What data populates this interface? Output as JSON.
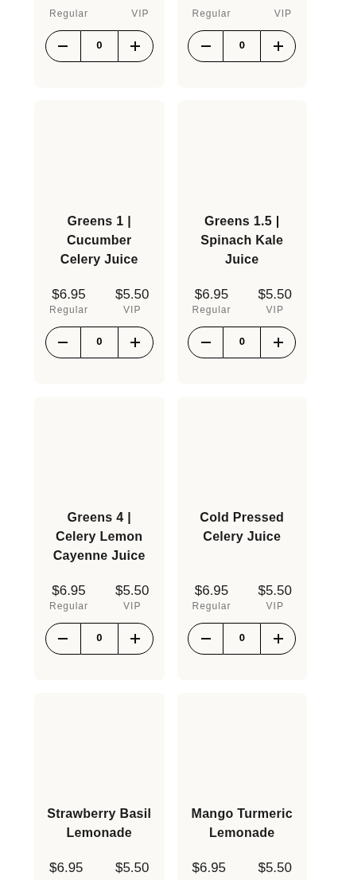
{
  "products": [
    {
      "regular_label": "Regular",
      "vip_label": "VIP",
      "quantity": "0"
    },
    {
      "regular_label": "Regular",
      "vip_label": "VIP",
      "quantity": "0"
    },
    {
      "title": "Greens 1 | Cucumber Celery Juice",
      "regular_price": "$6.95",
      "regular_label": "Regular",
      "vip_price": "$5.50",
      "vip_label": "VIP",
      "quantity": "0"
    },
    {
      "title": "Greens 1.5 | Spinach Kale Juice",
      "regular_price": "$6.95",
      "regular_label": "Regular",
      "vip_price": "$5.50",
      "vip_label": "VIP",
      "quantity": "0"
    },
    {
      "title": "Greens 4 | Celery Lemon Cayenne Juice",
      "regular_price": "$6.95",
      "regular_label": "Regular",
      "vip_price": "$5.50",
      "vip_label": "VIP",
      "quantity": "0"
    },
    {
      "title": "Cold Pressed Celery Juice",
      "regular_price": "$6.95",
      "regular_label": "Regular",
      "vip_price": "$5.50",
      "vip_label": "VIP",
      "quantity": "0"
    },
    {
      "title": "Strawberry Basil Lemonade",
      "regular_price": "$6.95",
      "vip_price": "$5.50"
    },
    {
      "title": "Mango Turmeric Lemonade",
      "regular_price": "$6.95",
      "vip_price": "$5.50"
    }
  ]
}
